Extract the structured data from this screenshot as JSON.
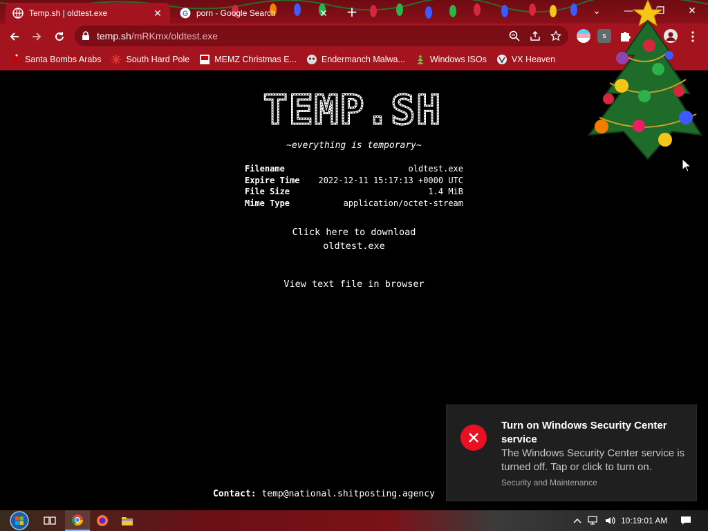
{
  "browser": {
    "tabs": [
      {
        "title": "Temp.sh | oldtest.exe",
        "icon": "temp-sh-favicon",
        "active": true
      },
      {
        "title": "porn - Google Search",
        "icon": "google-favicon",
        "active": false
      }
    ],
    "url": {
      "host": "temp.sh",
      "path": "/mRKmx/oldtest.exe"
    },
    "bookmarks": [
      {
        "label": "Santa Bombs Arabs",
        "icon": "santa-icon"
      },
      {
        "label": "South Hard Pole",
        "icon": "snowflake-icon"
      },
      {
        "label": "MEMZ Christmas E...",
        "icon": "memz-icon"
      },
      {
        "label": "Endermanch Malwa...",
        "icon": "endermanch-icon"
      },
      {
        "label": "Windows ISOs",
        "icon": "windows-isos-icon"
      },
      {
        "label": "VX Heaven",
        "icon": "vx-heaven-icon"
      }
    ],
    "theme_color": "#a3141e"
  },
  "page": {
    "logo_text": "TEMP.SH",
    "tagline": "~everything is temporary~",
    "file_info": [
      {
        "label": "Filename",
        "value": "oldtest.exe"
      },
      {
        "label": "Expire Time",
        "value": "2022-12-11 15:17:13 +0000 UTC"
      },
      {
        "label": "File Size",
        "value": "1.4 MiB"
      },
      {
        "label": "Mime Type",
        "value": "application/octet-stream"
      }
    ],
    "download_line1": "Click here to download",
    "download_line2": "oldtest.exe",
    "view_text": "View text file in browser",
    "contact_label": "Contact:",
    "contact_email": "temp@national.shitposting.agency"
  },
  "notification": {
    "title": "Turn on Windows Security Center service",
    "body": "The Windows Security Center service is turned off. Tap or click to turn on.",
    "source": "Security and Maintenance",
    "icon": "error-x-icon"
  },
  "taskbar": {
    "clock": "10:19:01 AM",
    "apps": [
      "start-button",
      "task-view",
      "chrome",
      "firefox",
      "file-explorer"
    ]
  }
}
